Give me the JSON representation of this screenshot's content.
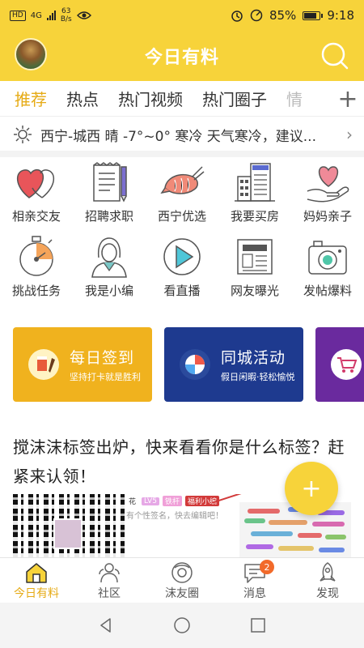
{
  "status_bar": {
    "network_badge": "HD",
    "network_type": "4G",
    "speed_value": "63",
    "speed_unit": "B/s",
    "battery": "85%",
    "battery_level": 0.85,
    "time": "9:18"
  },
  "header": {
    "title": "今日有料"
  },
  "tabs": [
    {
      "label": "推荐"
    },
    {
      "label": "热点"
    },
    {
      "label": "热门视频"
    },
    {
      "label": "热门圈子"
    },
    {
      "label": "情"
    }
  ],
  "tabs_more": "+",
  "weather": {
    "text": "西宁-城西 晴 -7°~0° 寒冷 天气寒冷，建议..."
  },
  "grid": [
    {
      "label": "相亲交友",
      "icon": "hearts-icon"
    },
    {
      "label": "招聘求职",
      "icon": "notepad-icon"
    },
    {
      "label": "西宁优选",
      "icon": "shrimp-icon"
    },
    {
      "label": "我要买房",
      "icon": "building-icon"
    },
    {
      "label": "妈妈亲子",
      "icon": "heart-hand-icon"
    },
    {
      "label": "挑战任务",
      "icon": "stopwatch-icon"
    },
    {
      "label": "我是小编",
      "icon": "person-icon"
    },
    {
      "label": "看直播",
      "icon": "play-icon"
    },
    {
      "label": "网友曝光",
      "icon": "newspaper-icon"
    },
    {
      "label": "发帖爆料",
      "icon": "camera-icon"
    }
  ],
  "banners": [
    {
      "title": "每日签到",
      "subtitle": "坚持打卡就是胜利",
      "color": "#f0b21e"
    },
    {
      "title": "同城活动",
      "subtitle": "假日闲暇·轻松愉悦",
      "color": "#1e3a8f"
    },
    {
      "title": "",
      "subtitle": "",
      "color": "#6a2a9e"
    }
  ],
  "article": {
    "title": "搅沫沫标签出炉，快来看看你是什么标签？赶紧来认领！",
    "image_tags": [
      "LV5",
      "铁杆",
      "福利小编"
    ],
    "image_name_fragment": "花",
    "image_caption": "有个性签名，快去编辑吧！"
  },
  "fab_label": "+",
  "bottom_nav": [
    {
      "label": "今日有料",
      "icon": "home-icon",
      "active": true
    },
    {
      "label": "社区",
      "icon": "community-icon"
    },
    {
      "label": "沫友圈",
      "icon": "circle-icon"
    },
    {
      "label": "消息",
      "icon": "message-icon",
      "badge": "2"
    },
    {
      "label": "发现",
      "icon": "rocket-icon"
    }
  ]
}
